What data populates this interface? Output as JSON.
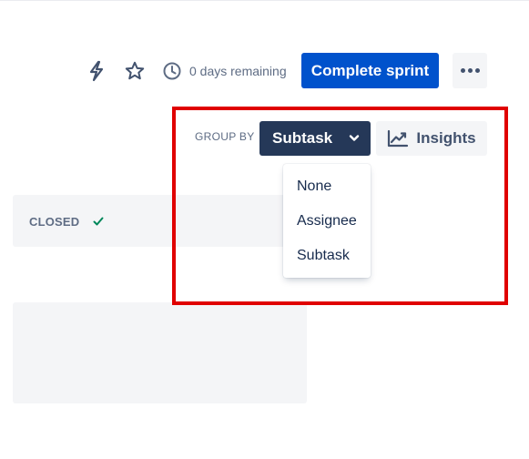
{
  "header": {
    "time_remaining": "0 days remaining",
    "complete_sprint_label": "Complete sprint"
  },
  "controls": {
    "group_by_label": "GROUP BY",
    "group_by_value": "Subtask",
    "insights_label": "Insights"
  },
  "group_by_menu": {
    "options": [
      "None",
      "Assignee",
      "Subtask"
    ]
  },
  "board": {
    "closed_label": "CLOSED"
  },
  "icons": {
    "lightning": "lightning-icon",
    "star": "star-icon",
    "clock": "clock-icon",
    "more": "more-icon",
    "chevron": "chevron-down-icon",
    "chart": "chart-icon",
    "check": "check-icon"
  },
  "colors": {
    "primary": "#0052cc",
    "group_button": "#253858",
    "highlight": "#e00000",
    "success": "#00875a"
  }
}
